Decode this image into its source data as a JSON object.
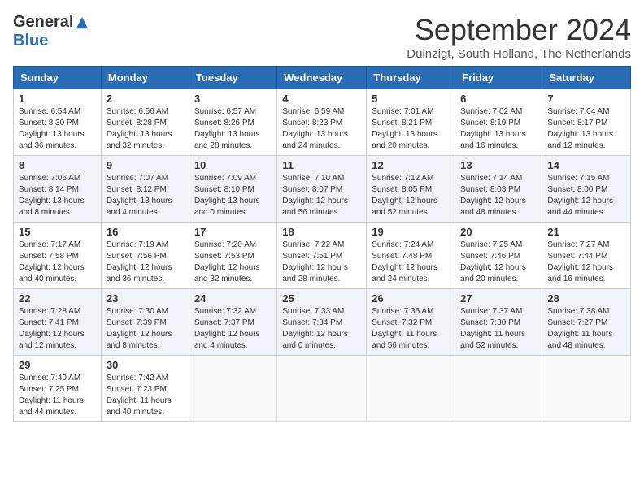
{
  "logo": {
    "general": "General",
    "blue": "Blue"
  },
  "title": "September 2024",
  "subtitle": "Duinzigt, South Holland, The Netherlands",
  "weekdays": [
    "Sunday",
    "Monday",
    "Tuesday",
    "Wednesday",
    "Thursday",
    "Friday",
    "Saturday"
  ],
  "weeks": [
    [
      {
        "day": "1",
        "sunrise": "6:54 AM",
        "sunset": "8:30 PM",
        "daylight": "13 hours and 36 minutes."
      },
      {
        "day": "2",
        "sunrise": "6:56 AM",
        "sunset": "8:28 PM",
        "daylight": "13 hours and 32 minutes."
      },
      {
        "day": "3",
        "sunrise": "6:57 AM",
        "sunset": "8:26 PM",
        "daylight": "13 hours and 28 minutes."
      },
      {
        "day": "4",
        "sunrise": "6:59 AM",
        "sunset": "8:23 PM",
        "daylight": "13 hours and 24 minutes."
      },
      {
        "day": "5",
        "sunrise": "7:01 AM",
        "sunset": "8:21 PM",
        "daylight": "13 hours and 20 minutes."
      },
      {
        "day": "6",
        "sunrise": "7:02 AM",
        "sunset": "8:19 PM",
        "daylight": "13 hours and 16 minutes."
      },
      {
        "day": "7",
        "sunrise": "7:04 AM",
        "sunset": "8:17 PM",
        "daylight": "13 hours and 12 minutes."
      }
    ],
    [
      {
        "day": "8",
        "sunrise": "7:06 AM",
        "sunset": "8:14 PM",
        "daylight": "13 hours and 8 minutes."
      },
      {
        "day": "9",
        "sunrise": "7:07 AM",
        "sunset": "8:12 PM",
        "daylight": "13 hours and 4 minutes."
      },
      {
        "day": "10",
        "sunrise": "7:09 AM",
        "sunset": "8:10 PM",
        "daylight": "13 hours and 0 minutes."
      },
      {
        "day": "11",
        "sunrise": "7:10 AM",
        "sunset": "8:07 PM",
        "daylight": "12 hours and 56 minutes."
      },
      {
        "day": "12",
        "sunrise": "7:12 AM",
        "sunset": "8:05 PM",
        "daylight": "12 hours and 52 minutes."
      },
      {
        "day": "13",
        "sunrise": "7:14 AM",
        "sunset": "8:03 PM",
        "daylight": "12 hours and 48 minutes."
      },
      {
        "day": "14",
        "sunrise": "7:15 AM",
        "sunset": "8:00 PM",
        "daylight": "12 hours and 44 minutes."
      }
    ],
    [
      {
        "day": "15",
        "sunrise": "7:17 AM",
        "sunset": "7:58 PM",
        "daylight": "12 hours and 40 minutes."
      },
      {
        "day": "16",
        "sunrise": "7:19 AM",
        "sunset": "7:56 PM",
        "daylight": "12 hours and 36 minutes."
      },
      {
        "day": "17",
        "sunrise": "7:20 AM",
        "sunset": "7:53 PM",
        "daylight": "12 hours and 32 minutes."
      },
      {
        "day": "18",
        "sunrise": "7:22 AM",
        "sunset": "7:51 PM",
        "daylight": "12 hours and 28 minutes."
      },
      {
        "day": "19",
        "sunrise": "7:24 AM",
        "sunset": "7:48 PM",
        "daylight": "12 hours and 24 minutes."
      },
      {
        "day": "20",
        "sunrise": "7:25 AM",
        "sunset": "7:46 PM",
        "daylight": "12 hours and 20 minutes."
      },
      {
        "day": "21",
        "sunrise": "7:27 AM",
        "sunset": "7:44 PM",
        "daylight": "12 hours and 16 minutes."
      }
    ],
    [
      {
        "day": "22",
        "sunrise": "7:28 AM",
        "sunset": "7:41 PM",
        "daylight": "12 hours and 12 minutes."
      },
      {
        "day": "23",
        "sunrise": "7:30 AM",
        "sunset": "7:39 PM",
        "daylight": "12 hours and 8 minutes."
      },
      {
        "day": "24",
        "sunrise": "7:32 AM",
        "sunset": "7:37 PM",
        "daylight": "12 hours and 4 minutes."
      },
      {
        "day": "25",
        "sunrise": "7:33 AM",
        "sunset": "7:34 PM",
        "daylight": "12 hours and 0 minutes."
      },
      {
        "day": "26",
        "sunrise": "7:35 AM",
        "sunset": "7:32 PM",
        "daylight": "11 hours and 56 minutes."
      },
      {
        "day": "27",
        "sunrise": "7:37 AM",
        "sunset": "7:30 PM",
        "daylight": "11 hours and 52 minutes."
      },
      {
        "day": "28",
        "sunrise": "7:38 AM",
        "sunset": "7:27 PM",
        "daylight": "11 hours and 48 minutes."
      }
    ],
    [
      {
        "day": "29",
        "sunrise": "7:40 AM",
        "sunset": "7:25 PM",
        "daylight": "11 hours and 44 minutes."
      },
      {
        "day": "30",
        "sunrise": "7:42 AM",
        "sunset": "7:23 PM",
        "daylight": "11 hours and 40 minutes."
      },
      null,
      null,
      null,
      null,
      null
    ]
  ]
}
